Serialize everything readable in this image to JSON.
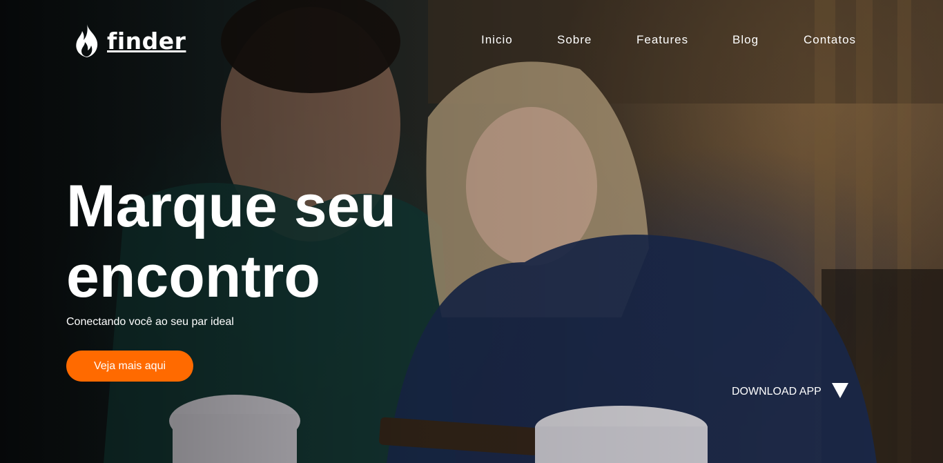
{
  "brand": {
    "name": "finder",
    "accent": "#ff6a00"
  },
  "nav": {
    "items": [
      {
        "label": "Inicio"
      },
      {
        "label": "Sobre"
      },
      {
        "label": "Features"
      },
      {
        "label": "Blog"
      },
      {
        "label": "Contatos"
      }
    ]
  },
  "hero": {
    "headline_line1": "Marque seu",
    "headline_line2": "encontro",
    "subtitle": "Conectando você ao seu par ideal",
    "cta_label": "Veja mais aqui",
    "download_label": "DOWNLOAD APP",
    "download_icon": "triangle-down-icon"
  }
}
